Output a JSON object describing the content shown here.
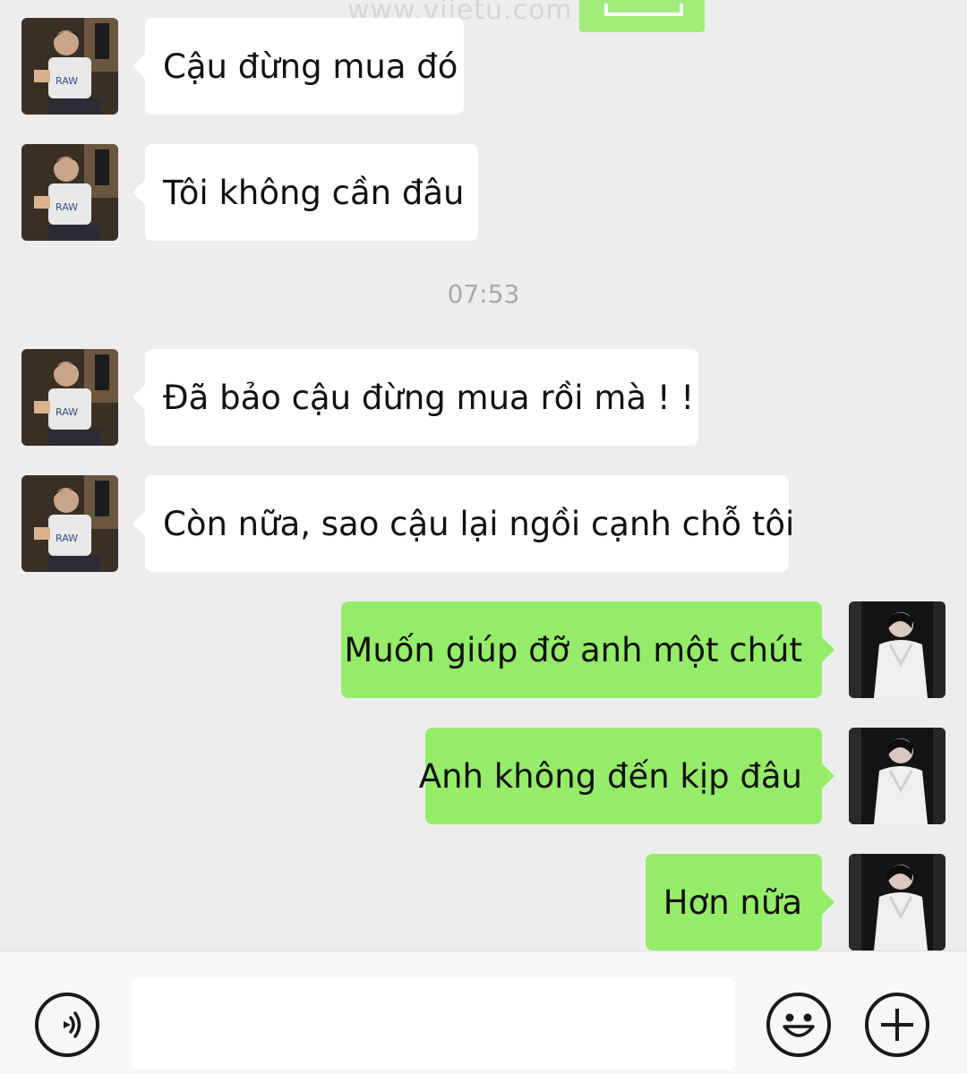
{
  "watermark": "www.vijetu.com",
  "divider_time": "07:53",
  "colors": {
    "background": "#ededed",
    "incoming_bubble": "#ffffff",
    "outgoing_bubble": "#95ec69",
    "timestamp": "#a9a9a9"
  },
  "messages": [
    {
      "side": "incoming",
      "text": "Cậu đừng mua đó"
    },
    {
      "side": "incoming",
      "text": "Tôi không cần đâu"
    },
    {
      "side": "incoming",
      "text": "Đã bảo cậu đừng mua rồi mà ! !"
    },
    {
      "side": "incoming",
      "text": "Còn nữa, sao cậu lại ngồi cạnh chỗ tôi"
    },
    {
      "side": "outgoing",
      "text": "Muốn giúp đỡ anh một chút"
    },
    {
      "side": "outgoing",
      "text": "Anh không đến kịp đâu"
    },
    {
      "side": "outgoing",
      "text": "Hơn nữa"
    }
  ],
  "input_bar": {
    "message_value": "",
    "voice_icon": "voice-icon",
    "emoji_icon": "emoji-icon",
    "plus_icon": "plus-icon"
  }
}
